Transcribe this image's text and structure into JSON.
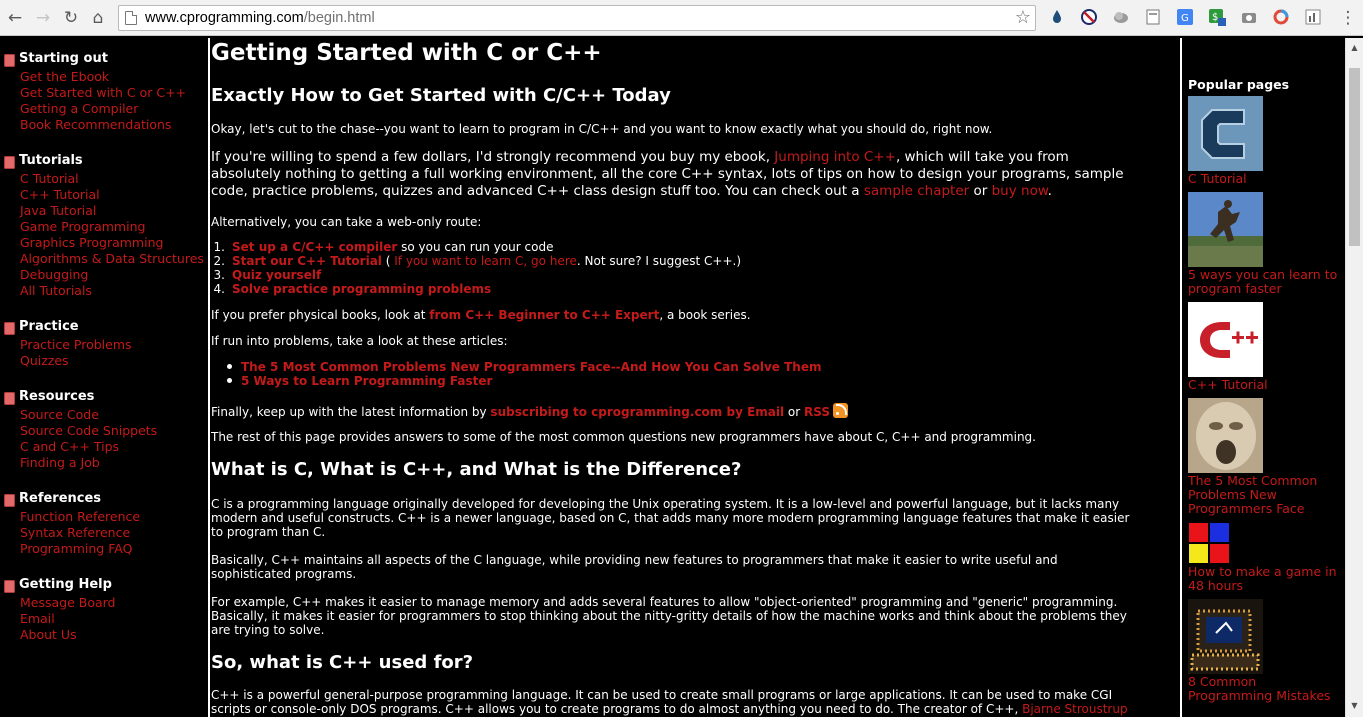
{
  "browser": {
    "url_domain": "www.cprogramming.com",
    "url_path": "/begin.html"
  },
  "sidebar": {
    "sections": [
      {
        "title": "Starting out",
        "items": [
          "Get the Ebook",
          "Get Started with C or C++",
          "Getting a Compiler",
          "Book Recommendations"
        ]
      },
      {
        "title": "Tutorials",
        "items": [
          "C Tutorial",
          "C++ Tutorial",
          "Java Tutorial",
          "Game Programming",
          "Graphics Programming",
          "Algorithms & Data Structures",
          "Debugging",
          "All Tutorials"
        ]
      },
      {
        "title": "Practice",
        "items": [
          "Practice Problems",
          "Quizzes"
        ]
      },
      {
        "title": "Resources",
        "items": [
          "Source Code",
          "Source Code Snippets",
          "C and C++ Tips",
          "Finding a Job"
        ]
      },
      {
        "title": "References",
        "items": [
          "Function Reference",
          "Syntax Reference",
          "Programming FAQ"
        ]
      },
      {
        "title": "Getting Help",
        "items": [
          "Message Board",
          "Email",
          "About Us"
        ]
      }
    ]
  },
  "main": {
    "title": "Getting Started with C or C++",
    "subtitle": "Exactly How to Get Started with C/C++ Today",
    "intro": "Okay, let's cut to the chase--you want to learn to program in C/C++ and you want to know exactly what you should do, right now.",
    "ebook_p": {
      "l1_a": "If you're willing to spend a few dollars, I'd strongly recommend you buy my ebook, ",
      "l1_link": "Jumping into C++",
      "l1_b": ", which will take you from",
      "l2": "absolutely nothing to getting a full working environment, all the core C++ syntax, lots of tips on how to design your programs, sample",
      "l3_a": "code, practice problems, quizzes and advanced C++ class design stuff too. You can check out a ",
      "l3_link1": "sample chapter",
      "l3_mid": " or ",
      "l3_link2": "buy now",
      "l3_end": "."
    },
    "alt_route": "Alternatively, you can take a web-only route:",
    "steps": {
      "s1_link": "Set up a C/C++ compiler",
      "s1_rest": " so you can run your code",
      "s2_link": "Start our C++ Tutorial",
      "s2_a": " ( ",
      "s2_link2": "If you want to learn C, go here",
      "s2_b": ". Not sure? I suggest C++.)",
      "s3_link": "Quiz yourself",
      "s4_link": "Solve practice programming problems"
    },
    "books": {
      "a": "If you prefer physical books, look at ",
      "link": "from C++ Beginner to C++ Expert",
      "b": ", a book series."
    },
    "problems_intro": "If run into problems, take a look at these articles:",
    "articles": [
      "The 5 Most Common Problems New Programmers Face--And How You Can Solve Them",
      "5 Ways to Learn Programming Faster"
    ],
    "latest": {
      "a": "Finally, keep up with the latest information by ",
      "link1": "subscribing to cprogramming.com by Email",
      "mid": " or ",
      "link2": "RSS"
    },
    "rest": "The rest of this page provides answers to some of the most common questions new programmers have about C, C++ and programming.",
    "h_diff": "What is C, What is C++, and What is the Difference?",
    "diff_p1_l1": "C is a programming language originally developed for developing the Unix operating system. It is a low-level and powerful language, but it lacks many",
    "diff_p1_l2": "modern and useful constructs. C++ is a newer language, based on C, that adds many more modern programming language features that make it easier",
    "diff_p1_l3": "to program than C.",
    "diff_p2_l1": "Basically, C++ maintains all aspects of the C language, while providing new features to programmers that make it easier to write useful and",
    "diff_p2_l2": "sophisticated programs.",
    "diff_p3_l1": "For example, C++ makes it easier to manage memory and adds several features to allow \"object-oriented\" programming and \"generic\" programming.",
    "diff_p3_l2": "Basically, it makes it easier for programmers to stop thinking about the nitty-gritty details of how the machine works and think about the problems they",
    "diff_p3_l3": "are trying to solve.",
    "h_used": "So, what is C++ used for?",
    "used_l1": "C++ is a powerful general-purpose programming language. It can be used to create small programs or large applications. It can be used to make CGI",
    "used_l2_a": "scripts or console-only DOS programs. C++ allows you to create programs to do almost anything you need to do. The creator of C++, ",
    "used_l2_link": "Bjarne Stroustrup"
  },
  "popular": {
    "title": "Popular pages",
    "items": [
      {
        "caption": "C Tutorial",
        "icon": "c-letter-thumbnail"
      },
      {
        "caption": "5 ways you can learn to program faster",
        "icon": "runner-statue-thumbnail"
      },
      {
        "caption": "C++ Tutorial",
        "icon": "cpp-logo-thumbnail"
      },
      {
        "caption": "The 5 Most Common Problems New Programmers Face",
        "icon": "stone-face-thumbnail"
      },
      {
        "caption": "How to make a game in 48 hours",
        "icon": "color-squares-thumbnail"
      },
      {
        "caption": "8 Common Programming Mistakes",
        "icon": "christmas-lights-thumbnail"
      }
    ]
  },
  "colors": {
    "link": "#c41a1a",
    "background": "#000000",
    "text": "#ffffff"
  }
}
